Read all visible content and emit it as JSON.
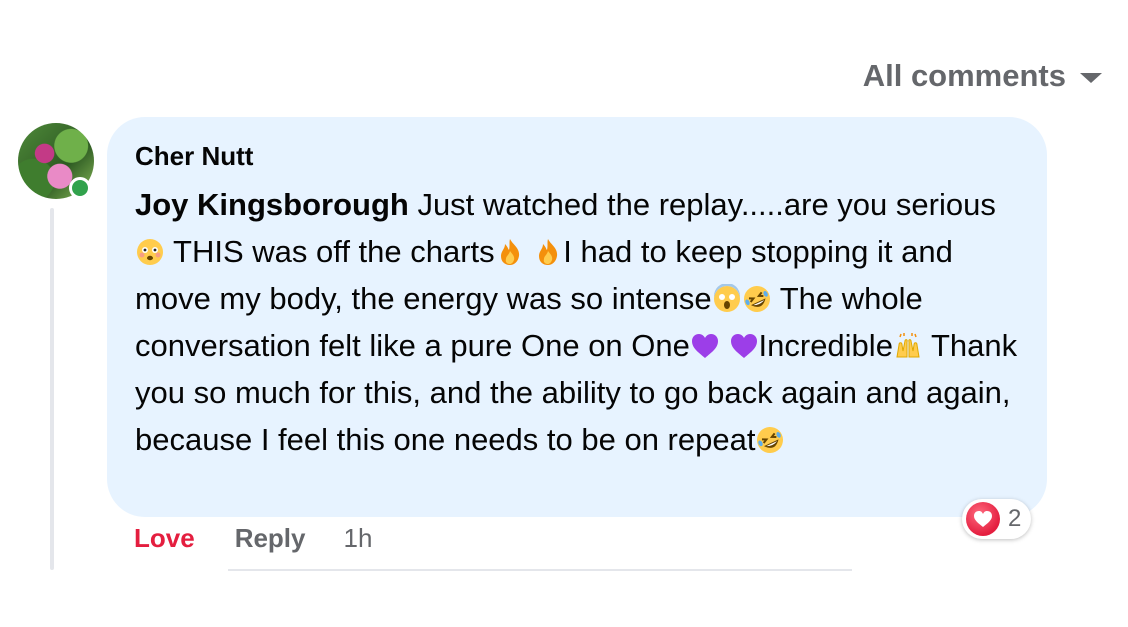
{
  "sort": {
    "label": "All comments"
  },
  "comment": {
    "author": "Cher Nutt",
    "mention": "Joy Kingsborough",
    "segments": {
      "s1": " Just watched the replay.....are you serious",
      "s2": " THIS was off the charts",
      "s3": "I had to keep stopping it and move my body, the energy was so intense",
      "s4": " The whole conversation felt like a pure One on One",
      "s5": "Incredible",
      "s6": " Thank you so much for this, and the ability to go back again and again, because I feel this one needs to be on repeat"
    },
    "reaction_count": "2"
  },
  "actions": {
    "love": "Love",
    "reply": "Reply",
    "time": "1h"
  },
  "colors": {
    "bubble": "#e7f3ff",
    "love": "#e41e3f",
    "secondary": "#65676b",
    "online": "#31a24c"
  },
  "icons": [
    "caret-down-icon",
    "flushed-face-icon",
    "fire-icon",
    "screaming-face-icon",
    "rofl-face-icon",
    "purple-heart-icon",
    "raised-hands-icon",
    "heart-reaction-icon"
  ]
}
